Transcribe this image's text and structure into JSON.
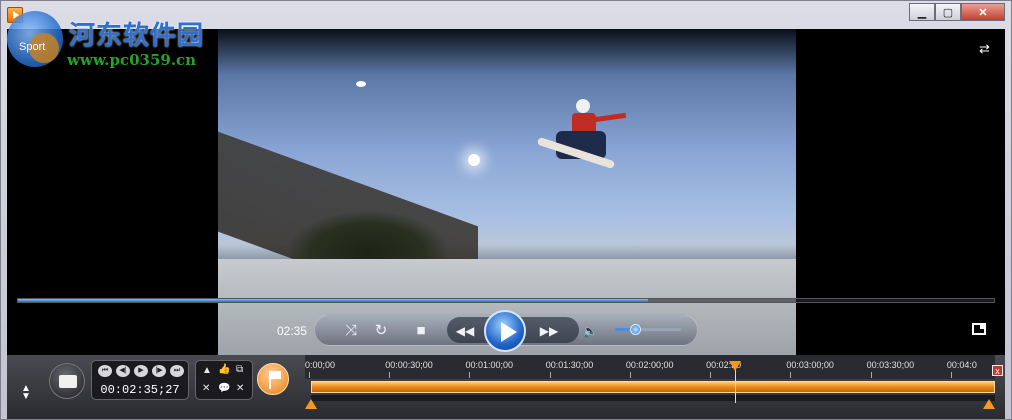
{
  "watermark": {
    "title": "河东软件园",
    "url": "www.pc0359.cn",
    "logo_text": "Sport"
  },
  "window_controls": {
    "minimize": "▁",
    "maximize": "▢",
    "close": "✕"
  },
  "player": {
    "elapsed": "02:35",
    "progress_fraction": 0.645,
    "volume_fraction": 0.3,
    "buttons": {
      "crossfade": "⤨",
      "repeat": "↻",
      "stop": "■",
      "rewind": "◀◀",
      "forward": "▶▶",
      "volume": "🔈"
    }
  },
  "bottom_bar": {
    "timecode": "00:02:35;27",
    "transport": [
      "⏮",
      "◀|",
      "▶",
      "|▶",
      "⏭"
    ],
    "edit_icons": [
      "▲",
      "👍",
      "⧉",
      "✕",
      "💬",
      "✕"
    ],
    "ruler_labels": [
      "0:00;00",
      "00:00:30;00",
      "00:01:00;00",
      "00:01:30;00",
      "00:02:00;00",
      "00:02:30",
      "00:03:00;00",
      "00:03:30;00",
      "00:04:0"
    ],
    "playhead_fraction": 0.62
  },
  "icons": {
    "app": "app-icon",
    "pip": "pip-icon",
    "fullscreen": "fullscreen-icon",
    "open": "folder-icon",
    "flag": "flag-icon"
  },
  "colors": {
    "accent": "#f39a1e",
    "progress": "#1f6fd0",
    "timeline": "#ee8a1a"
  }
}
